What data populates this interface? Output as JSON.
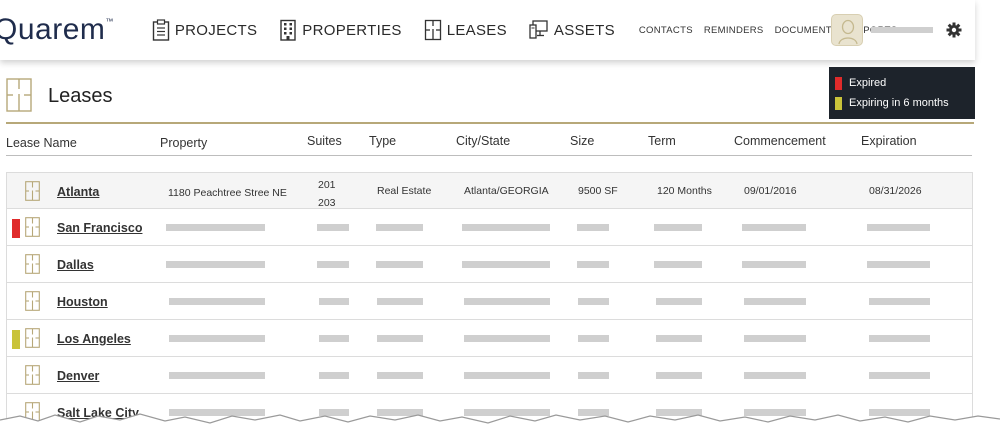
{
  "app": {
    "logo": "Quarem",
    "logo_mark": "™"
  },
  "nav": {
    "main": [
      {
        "label": "PROJECTS",
        "icon": "clipboard-icon"
      },
      {
        "label": "PROPERTIES",
        "icon": "building-icon"
      },
      {
        "label": "LEASES",
        "icon": "floorplan-icon"
      },
      {
        "label": "ASSETS",
        "icon": "computer-icon"
      }
    ],
    "secondary": [
      "CONTACTS",
      "REMINDERS",
      "DOCUMENTS",
      "REPORTS"
    ]
  },
  "legend": {
    "items": [
      {
        "label": "Expired",
        "color": "#e02b2b"
      },
      {
        "label": "Expiring in 6 months",
        "color": "#c9c33a"
      }
    ]
  },
  "page": {
    "title": "Leases",
    "icon": "floorplan-icon"
  },
  "columns": [
    "Lease Name",
    "Property",
    "Suites",
    "Type",
    "City/State",
    "Size",
    "Term",
    "Commencement",
    "Expiration"
  ],
  "rows": [
    {
      "name": "Atlanta",
      "status": "none",
      "property": "1180 Peachtree Stree NE",
      "suites": [
        "201",
        "203"
      ],
      "type": "Real Estate",
      "city_state": "Atlanta/GEORGIA",
      "size": "9500 SF",
      "term": "120 Months",
      "commencement": "09/01/2016",
      "expiration": "08/31/2026"
    },
    {
      "name": "San Francisco",
      "status": "expired"
    },
    {
      "name": "Dallas",
      "status": "none"
    },
    {
      "name": "Houston",
      "status": "none"
    },
    {
      "name": "Los Angeles",
      "status": "expiring"
    },
    {
      "name": "Denver",
      "status": "none"
    },
    {
      "name": "Salt Lake City",
      "status": "none"
    }
  ],
  "colors": {
    "accent_gold": "#b7a879",
    "expired": "#e02b2b",
    "expiring": "#c9c33a",
    "legend_bg": "#1d232b",
    "logo_navy": "#1f2c4c"
  }
}
